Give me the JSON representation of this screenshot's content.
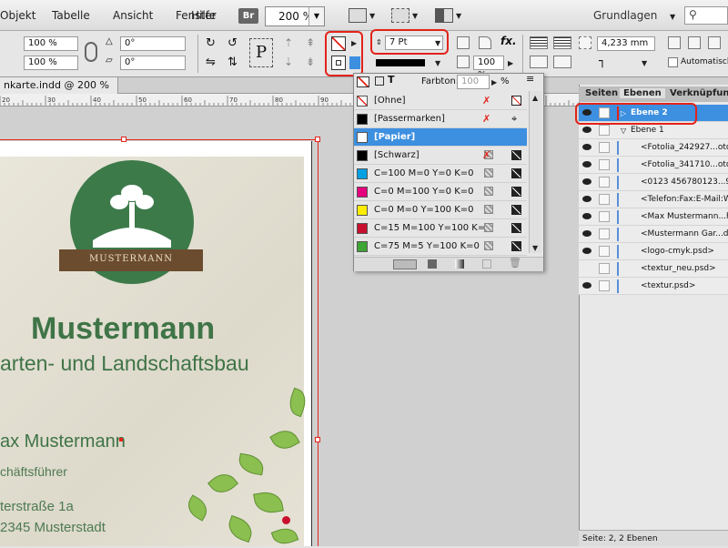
{
  "menu": {
    "items": [
      "Objekt",
      "Tabelle",
      "Ansicht",
      "Fenster",
      "Hilfe"
    ],
    "bridge_label": "Br",
    "zoom": "200 %",
    "workspace": "Grundlagen"
  },
  "control": {
    "scale_x": "100 %",
    "scale_y": "100 %",
    "rotate": "0°",
    "shear": "0°",
    "stroke_weight": "7 Pt",
    "tint": "100 %",
    "ref_width": "4,233 mm",
    "auto_fit_label": "Automatisch",
    "frame_type_label": "P"
  },
  "document": {
    "tab_label": "nkarte.indd @ 200 %",
    "ruler_labels": [
      "20",
      "30",
      "40",
      "50",
      "60",
      "70",
      "80",
      "90",
      "100",
      "110",
      "120",
      "130"
    ]
  },
  "card": {
    "logo_text": "MUSTERMANN",
    "title": "Mustermann",
    "subtitle": "arten- und Landschaftsbau",
    "person_name": "ax Mustermann",
    "person_role": "chäftsführer",
    "street": "terstraße 1a",
    "city": "2345 Musterstadt"
  },
  "swatches": {
    "tint_label": "Farbton:",
    "tint_value": "100",
    "tint_unit": "%",
    "items": [
      {
        "label": "[Ohne]",
        "color": "none"
      },
      {
        "label": "[Passermarken]",
        "color": "#000000"
      },
      {
        "label": "[Papier]",
        "color": "#ffffff",
        "selected": true
      },
      {
        "label": "[Schwarz]",
        "color": "#000000"
      },
      {
        "label": "C=100 M=0 Y=0 K=0",
        "color": "#00a0e3"
      },
      {
        "label": "C=0 M=100 Y=0 K=0",
        "color": "#e6007e"
      },
      {
        "label": "C=0 M=0 Y=100 K=0",
        "color": "#ffed00"
      },
      {
        "label": "C=15 M=100 Y=100 K=0",
        "color": "#c8102e"
      },
      {
        "label": "C=75 M=5 Y=100 K=0",
        "color": "#3fa535"
      }
    ]
  },
  "layers_panel": {
    "tabs": [
      "Seiten",
      "Ebenen",
      "Verknüpfunge"
    ],
    "layers": [
      {
        "label": "Ebene 2",
        "selected": true,
        "level": 0,
        "collapsed": true
      },
      {
        "label": "Ebene 1",
        "level": 0,
        "expanded": true
      },
      {
        "label": "<Fotolia_242927...otoli",
        "level": 1
      },
      {
        "label": "<Fotolia_341710...otoli",
        "level": 1
      },
      {
        "label": "<0123 456780123...9gf",
        "level": 1
      },
      {
        "label": "<Telefon:Fax:E-Mail:We",
        "level": 1
      },
      {
        "label": "<Max Mustermann...hä",
        "level": 1
      },
      {
        "label": "<Mustermann Gar...d L",
        "level": 1
      },
      {
        "label": "<logo-cmyk.psd>",
        "level": 1
      },
      {
        "label": "<textur_neu.psd>",
        "level": 1,
        "hidden": true
      },
      {
        "label": "<textur.psd>",
        "level": 1
      }
    ],
    "status": "Seite: 2, 2 Ebenen"
  },
  "colors": {
    "accent_red": "#e2231a",
    "selection_blue": "#3d8fe0",
    "brand_green": "#3f7447"
  }
}
